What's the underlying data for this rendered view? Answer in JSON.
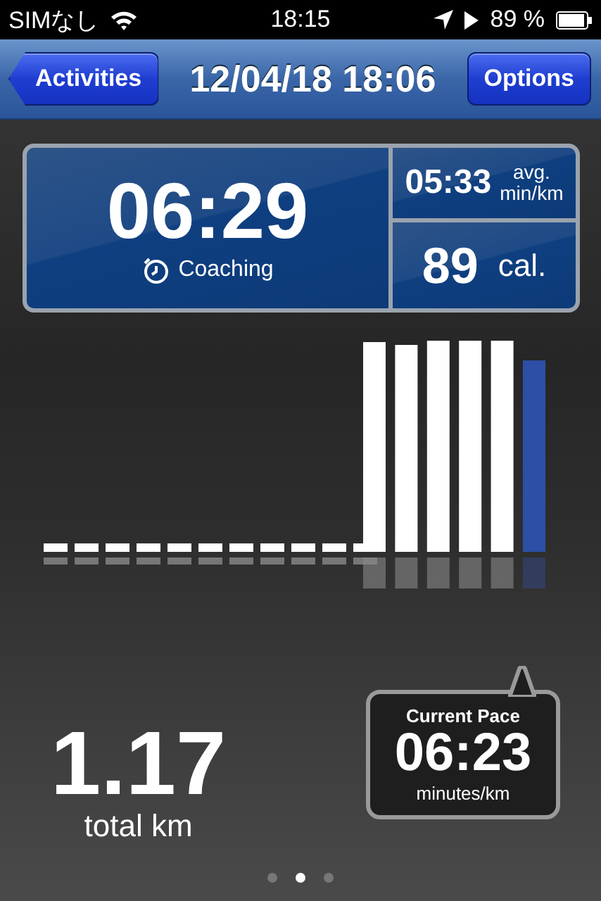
{
  "status_bar": {
    "carrier": "SIMなし",
    "time": "18:15",
    "battery": "89 %"
  },
  "nav_bar": {
    "back_button": "Activities",
    "title": "12/04/18 18:06",
    "right_button": "Options"
  },
  "stats": {
    "duration": "06:29",
    "coaching": "Coaching",
    "avg_pace": "05:33",
    "avg_pace_unit_top": "avg.",
    "avg_pace_unit_bottom": "min/km",
    "calories": "89",
    "calories_unit": "cal."
  },
  "distance": {
    "value": "1.17",
    "unit": "total km"
  },
  "current_pace": {
    "title": "Current Pace",
    "value": "06:23",
    "unit": "minutes/km"
  },
  "pages": [
    {
      "selected": false
    },
    {
      "selected": true
    },
    {
      "selected": false
    }
  ]
}
